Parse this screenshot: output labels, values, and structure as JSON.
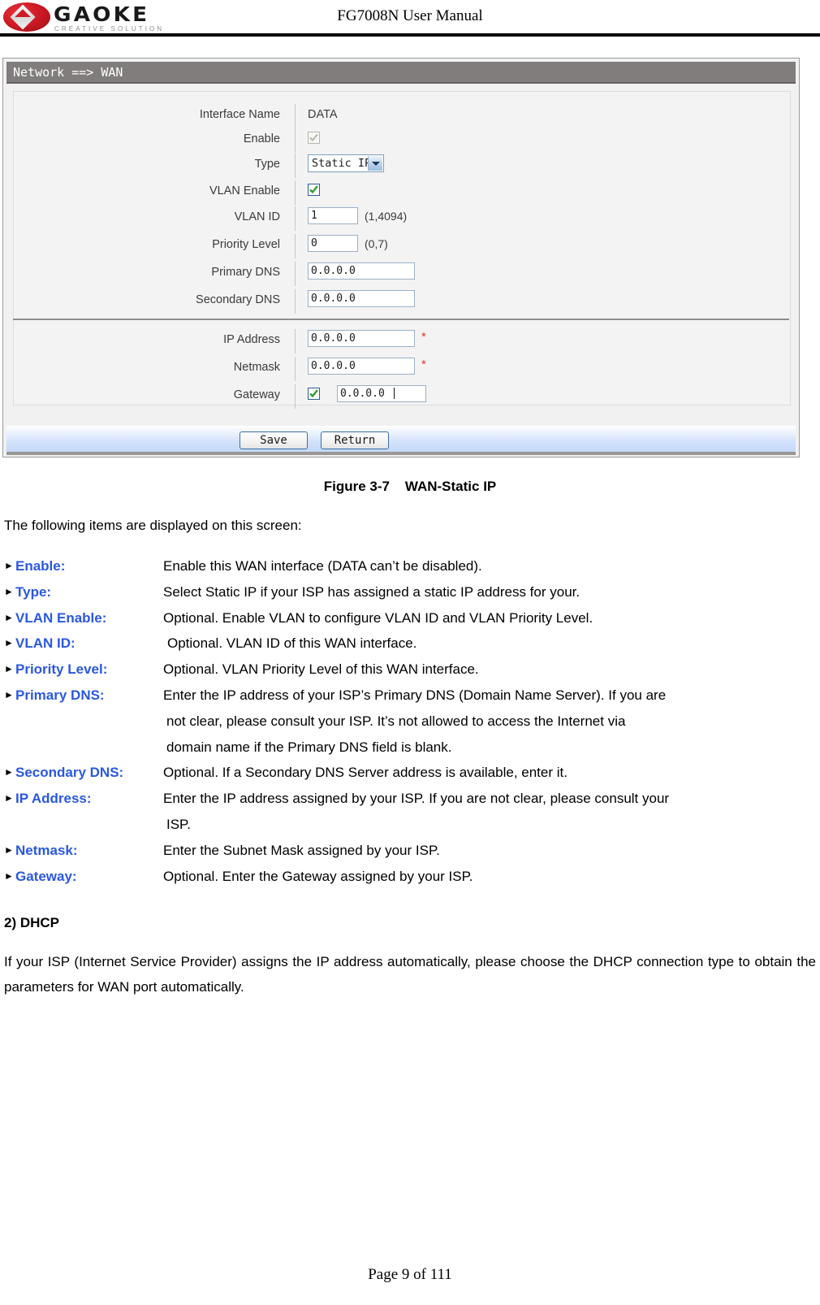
{
  "header": {
    "logo_word": "GAOKE",
    "logo_tagline": "CREATIVE SOLUTION",
    "manual_title": "FG7008N User Manual"
  },
  "ui_panel": {
    "breadcrumb": "Network ==> WAN",
    "rows": [
      {
        "label": "Interface Name",
        "value": "DATA"
      },
      {
        "label": "Enable",
        "checkbox": "checked-disabled"
      },
      {
        "label": "Type",
        "select_value": "Static IP"
      },
      {
        "label": "VLAN Enable",
        "checkbox": "checked"
      },
      {
        "label": "VLAN ID",
        "value": "1",
        "hint": "(1,4094)"
      },
      {
        "label": "Priority Level",
        "value": "0",
        "hint": "(0,7)"
      },
      {
        "label": "Primary DNS",
        "value": "0.0.0.0"
      },
      {
        "label": "Secondary DNS",
        "value": "0.0.0.0"
      },
      {
        "label": "IP Address",
        "value": "0.0.0.0",
        "required": "*"
      },
      {
        "label": "Netmask",
        "value": "0.0.0.0",
        "required": "*"
      },
      {
        "label": "Gateway",
        "checkbox": "checked",
        "value": "0.0.0.0"
      }
    ],
    "buttons": {
      "save": "Save",
      "return": "Return"
    },
    "colors": {
      "titlebar": "#817d7c",
      "panel_bg": "#f1f1f1",
      "required_mark": "#e03b29",
      "checkbox_check": "#2f9c2f"
    }
  },
  "figure": {
    "caption": "Figure 3-7    WAN-Static IP"
  },
  "body": {
    "intro": "The following items are displayed on this screen:",
    "definitions": [
      {
        "term": "Enable:",
        "desc": "Enable this WAN interface (DATA can’t be disabled)."
      },
      {
        "term": "Type:",
        "desc": "Select Static IP if your ISP has assigned a static IP address for your."
      },
      {
        "term": "VLAN Enable:",
        "desc": "Optional. Enable VLAN to configure VLAN ID and VLAN Priority Level."
      },
      {
        "term": "VLAN ID:",
        "desc": "Optional. VLAN ID of this WAN interface."
      },
      {
        "term": "Priority Level:",
        "desc": "Optional. VLAN Priority Level of this WAN interface."
      },
      {
        "term": "Primary DNS:",
        "desc": "Enter the IP address of your ISP’s Primary DNS (Domain Name Server). If you are",
        "desc2": "not clear, please consult your ISP. It’s not allowed to access the Internet via",
        "desc3": "domain name if the Primary DNS field is blank."
      },
      {
        "term": "Secondary DNS:",
        "desc": "Optional. If a Secondary DNS Server address is available, enter it."
      },
      {
        "term": "IP Address:",
        "desc": "Enter the IP address assigned by your ISP. If you are not clear, please consult your",
        "desc2": "ISP."
      },
      {
        "term": "Netmask:",
        "desc": "Enter the Subnet Mask assigned by your ISP."
      },
      {
        "term": "Gateway:",
        "desc": "Optional. Enter the Gateway assigned by your ISP."
      }
    ],
    "subheading": "2) DHCP",
    "paragraph": "If your ISP (Internet Service Provider) assigns the IP address automatically, please choose the DHCP connection type to obtain the parameters for WAN port automatically."
  },
  "footer": {
    "page_label": "Page 9 of 111"
  }
}
